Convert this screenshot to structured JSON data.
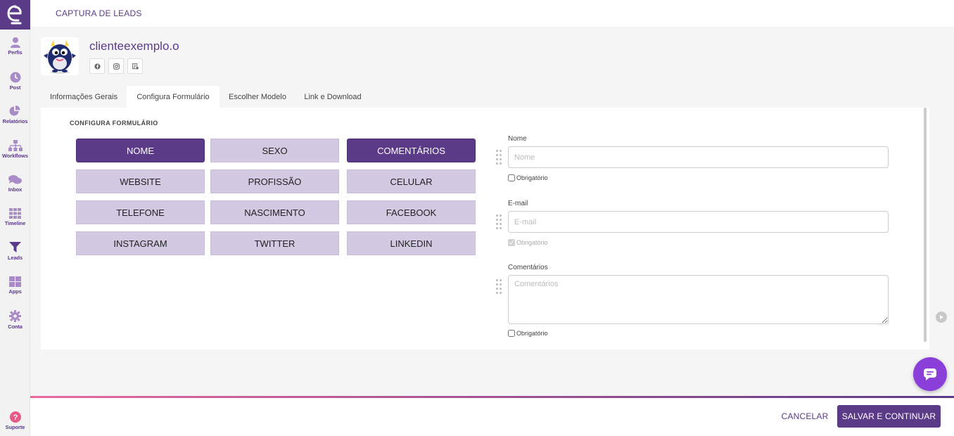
{
  "app": {
    "title": "CAPTURA DE LEADS",
    "accent": "#5b3a88"
  },
  "sidebar": {
    "items": [
      {
        "label": "Perfis",
        "icon": "user-icon"
      },
      {
        "label": "Post",
        "icon": "clock-icon"
      },
      {
        "label": "Relatórios",
        "icon": "pie-chart-icon"
      },
      {
        "label": "Workflows",
        "icon": "sitemap-icon"
      },
      {
        "label": "Inbox",
        "icon": "chat-icon"
      },
      {
        "label": "Timeline",
        "icon": "grid-icon"
      },
      {
        "label": "Leads",
        "icon": "filter-icon"
      },
      {
        "label": "Apps",
        "icon": "apps-icon"
      },
      {
        "label": "Conta",
        "icon": "gear-icon"
      }
    ],
    "support": {
      "label": "Suporte",
      "icon": "help-icon"
    }
  },
  "profile": {
    "name": "clienteexemplo.o",
    "socials": [
      "facebook-icon",
      "instagram-icon",
      "form-icon"
    ]
  },
  "tabs": [
    {
      "label": "Informações Gerais",
      "active": false
    },
    {
      "label": "Configura Formulário",
      "active": true
    },
    {
      "label": "Escolher Modelo",
      "active": false
    },
    {
      "label": "Link e Download",
      "active": false
    }
  ],
  "form_config": {
    "section_title": "CONFIGURA FORMULÁRIO",
    "fields": [
      {
        "label": "NOME",
        "selected": true
      },
      {
        "label": "SEXO",
        "selected": false
      },
      {
        "label": "COMENTÁRIOS",
        "selected": true
      },
      {
        "label": "WEBSITE",
        "selected": false
      },
      {
        "label": "PROFISSÃO",
        "selected": false
      },
      {
        "label": "CELULAR",
        "selected": false
      },
      {
        "label": "TELEFONE",
        "selected": false
      },
      {
        "label": "NASCIMENTO",
        "selected": false
      },
      {
        "label": "FACEBOOK",
        "selected": false
      },
      {
        "label": "INSTAGRAM",
        "selected": false
      },
      {
        "label": "TWITTER",
        "selected": false
      },
      {
        "label": "LINKEDIN",
        "selected": false
      }
    ]
  },
  "preview": {
    "nome": {
      "label": "Nome",
      "placeholder": "Nome",
      "required_label": "Obrigatório"
    },
    "email": {
      "label": "E-mail",
      "placeholder": "E-mail",
      "required_label": "Obrigatório"
    },
    "comentarios": {
      "label": "Comentários",
      "placeholder": "Comentários",
      "required_label": "Obrigatório"
    }
  },
  "footer": {
    "cancel_label": "CANCELAR",
    "save_label": "SALVAR E CONTINUAR"
  }
}
